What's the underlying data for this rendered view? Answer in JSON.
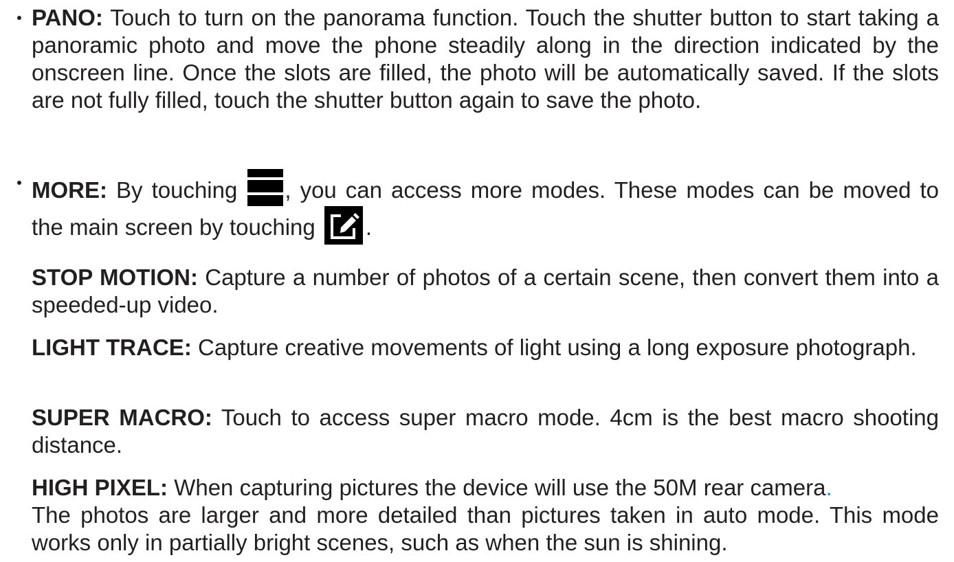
{
  "pano": {
    "term": "PANO:",
    "text": "Touch to turn on the panorama function. Touch the shutter button to start taking a panoramic photo and move the phone steadily along in the direction indicated by the onscreen line. Once the slots are filled, the photo will be automatically saved. If the slots are not fully filled, touch the shutter button again to save the photo."
  },
  "more": {
    "term": "MORE:",
    "text_before_icon": "By touching",
    "text_middle": ", you can access more modes. These modes can be moved to the main screen by touching",
    "text_end": ".",
    "menu_icon": "menu-icon",
    "edit_icon": "edit-icon"
  },
  "stop_motion": {
    "term": "STOP MOTION:",
    "text": "Capture a number of photos of a certain scene, then convert them into a speeded-up video."
  },
  "light_trace": {
    "term": "LIGHT TRACE:",
    "text": "Capture creative movements of light using a long exposure photograph."
  },
  "super_macro": {
    "term": "SUPER MACRO:",
    "text": "Touch to access super macro mode. 4cm is the best macro shooting distance."
  },
  "high_pixel": {
    "term": "HIGH PIXEL:",
    "text_line1": "When capturing pictures the device will use the 50M rear camera",
    "accent_period": ".",
    "text_rest": "The photos are larger and more detailed than pictures taken in auto mode. This mode works only in partially bright scenes, such as when the sun is shining."
  },
  "colors": {
    "text": "#231f20",
    "accent": "#0d8fc9",
    "icon_bg": "#000000"
  }
}
